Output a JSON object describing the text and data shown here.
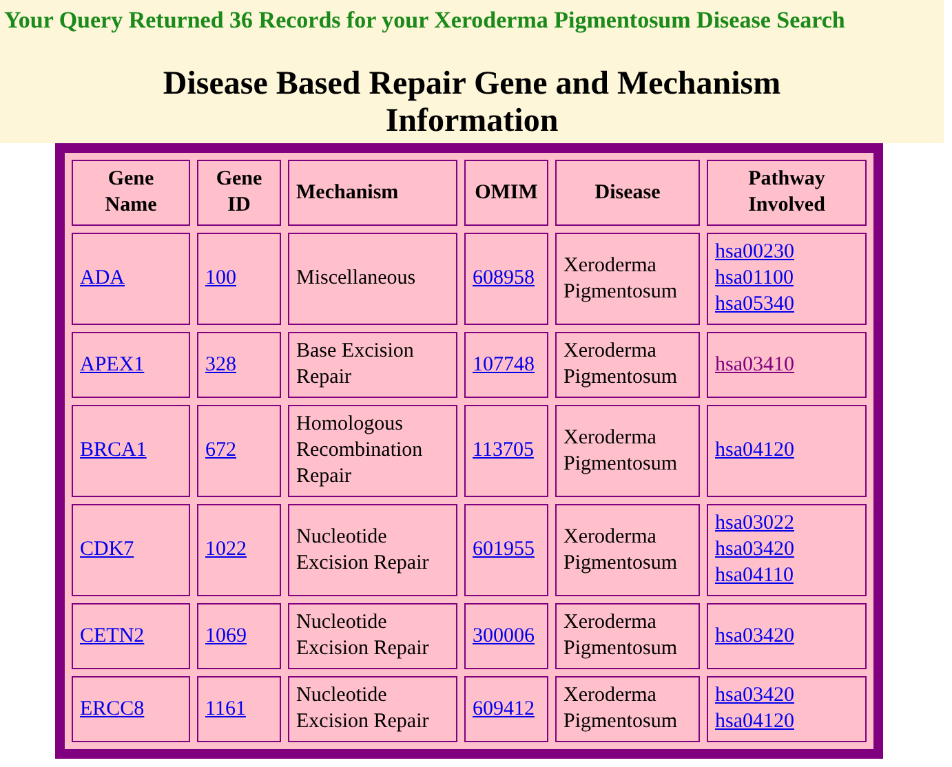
{
  "query_summary": "Your Query Returned 36 Records for your Xeroderma Pigmentosum Disease Search",
  "heading": "Disease Based Repair Gene and Mechanism Information",
  "table": {
    "columns": [
      "Gene Name",
      "Gene ID",
      "Mechanism",
      "OMIM",
      "Disease",
      "Pathway Involved"
    ],
    "rows": [
      {
        "gene_name": "ADA",
        "gene_id": "100",
        "mechanism": "Miscellaneous",
        "omim": "608958",
        "disease": "Xeroderma Pigmentosum",
        "pathways": [
          {
            "label": "hsa00230",
            "visited": false
          },
          {
            "label": "hsa01100",
            "visited": false
          },
          {
            "label": "hsa05340",
            "visited": false
          }
        ]
      },
      {
        "gene_name": "APEX1",
        "gene_id": "328",
        "mechanism": "Base Excision Repair",
        "omim": "107748",
        "disease": "Xeroderma Pigmentosum",
        "pathways": [
          {
            "label": "hsa03410",
            "visited": true
          }
        ]
      },
      {
        "gene_name": "BRCA1",
        "gene_id": "672",
        "mechanism": "Homologous Recombination Repair",
        "omim": "113705",
        "disease": "Xeroderma Pigmentosum",
        "pathways": [
          {
            "label": "hsa04120",
            "visited": false
          }
        ]
      },
      {
        "gene_name": "CDK7",
        "gene_id": "1022",
        "mechanism": "Nucleotide Excision Repair",
        "omim": "601955",
        "disease": "Xeroderma Pigmentosum",
        "pathways": [
          {
            "label": "hsa03022",
            "visited": false
          },
          {
            "label": "hsa03420",
            "visited": false
          },
          {
            "label": "hsa04110",
            "visited": false
          }
        ]
      },
      {
        "gene_name": "CETN2",
        "gene_id": "1069",
        "mechanism": "Nucleotide Excision Repair",
        "omim": "300006",
        "disease": "Xeroderma Pigmentosum",
        "pathways": [
          {
            "label": "hsa03420",
            "visited": false
          }
        ]
      },
      {
        "gene_name": "ERCC8",
        "gene_id": "1161",
        "mechanism": "Nucleotide Excision Repair",
        "omim": "609412",
        "disease": "Xeroderma Pigmentosum",
        "pathways": [
          {
            "label": "hsa03420",
            "visited": false
          },
          {
            "label": "hsa04120",
            "visited": false
          }
        ]
      }
    ]
  }
}
